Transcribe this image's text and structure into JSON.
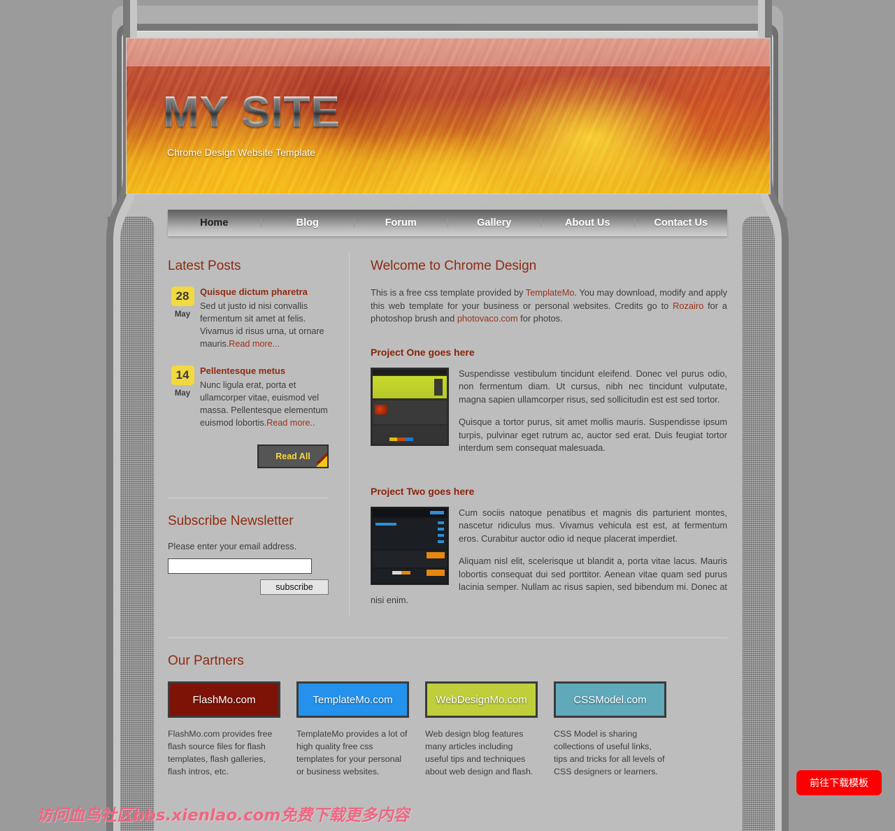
{
  "banner": {
    "title": "MY SITE",
    "subtitle": "Chrome Design Website Template"
  },
  "nav": {
    "items": [
      {
        "label": "Home",
        "active": true
      },
      {
        "label": "Blog",
        "active": false
      },
      {
        "label": "Forum",
        "active": false
      },
      {
        "label": "Gallery",
        "active": false
      },
      {
        "label": "About Us",
        "active": false
      },
      {
        "label": "Contact Us",
        "active": false
      }
    ]
  },
  "sidebar": {
    "latest_posts_heading": "Latest Posts",
    "posts": [
      {
        "day": "28",
        "month": "May",
        "title": "Quisque dictum pharetra",
        "text": "Sed ut justo id nisi convallis fermentum sit amet at felis. Vivamus id risus urna, ut ornare mauris.",
        "read_more": "Read more..."
      },
      {
        "day": "14",
        "month": "May",
        "title": "Pellentesque metus",
        "text": "Nunc ligula erat, porta et ullamcorper vitae, euismod vel massa. Pellentesque elementum euismod lobortis.",
        "read_more": "Read more.."
      }
    ],
    "read_all_label": "Read All",
    "newsletter_heading": "Subscribe Newsletter",
    "newsletter_note": "Please enter your email address.",
    "email_value": "",
    "email_placeholder": "",
    "subscribe_label": "subscribe"
  },
  "main": {
    "welcome_heading": "Welcome to Chrome Design",
    "intro": {
      "part1": "This is a free css template provided by ",
      "link1": "TemplateMo",
      "part2": ". You may download, modify and apply this web template for your business or personal websites. Credits go to ",
      "link2": "Rozairo",
      "part3": " for a photoshop brush and ",
      "link3": "photovaco.com",
      "part4": " for photos."
    },
    "project_one": {
      "heading": "Project One goes here",
      "paragraph1": "Suspendisse vestibulum tincidunt eleifend. Donec vel purus odio, non fermentum diam. Ut cursus, nibh nec tincidunt vulputate, magna sapien ullamcorper risus, sed sollicitudin est est sed tortor.",
      "paragraph2": "Quisque a tortor purus, sit amet mollis mauris. Suspendisse ipsum turpis, pulvinar eget rutrum ac, auctor sed erat. Duis feugiat tortor interdum sem consequat malesuada."
    },
    "project_two": {
      "heading": "Project Two goes here",
      "paragraph1": "Cum sociis natoque penatibus et magnis dis parturient montes, nascetur ridiculus mus. Vivamus vehicula est est, at fermentum eros. Curabitur auctor odio id neque placerat imperdiet.",
      "paragraph2": "Aliquam nisl elit, scelerisque ut blandit a, porta vitae lacus. Mauris lobortis consequat dui sed porttitor. Aenean vitae quam sed purus lacinia semper. Nullam ac risus sapien, sed bibendum mi. Donec at nisi enim."
    }
  },
  "partners": {
    "heading": "Our Partners",
    "items": [
      {
        "name": "FlashMo.com",
        "color": "#7d1307",
        "desc": "FlashMo.com provides free flash source files for flash templates, flash galleries, flash intros, etc."
      },
      {
        "name": "TemplateMo.com",
        "color": "#2492ec",
        "desc": "TemplateMo provides a lot of high quality free css templates for your personal or business websites."
      },
      {
        "name": "WebDesignMo.com",
        "color": "#bfcf3c",
        "desc": "Web design blog features many articles including useful tips and techniques about web design and flash."
      },
      {
        "name": "CSSModel.com",
        "color": "#5fa9bb",
        "desc": "CSS Model is sharing collections of useful links, tips and tricks for all levels of CSS designers or learners."
      }
    ]
  },
  "overlay": {
    "watermark": "访问血鸟社区bbs.xienlao.com免费下载更多内容",
    "download_button": "前往下载模板"
  }
}
